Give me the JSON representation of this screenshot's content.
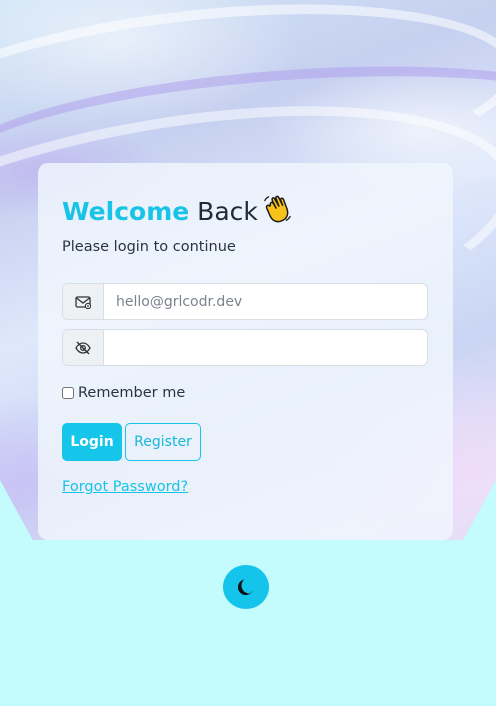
{
  "colors": {
    "accent": "#17c3e6",
    "text": "#222a35",
    "page_background": "#c4fbfd"
  },
  "login_card": {
    "title_accent": "Welcome",
    "title_rest": "Back",
    "title_icon": "waving-hand-icon",
    "subtitle": "Please login to continue",
    "email_field": {
      "icon": "envelope-icon",
      "value": "",
      "placeholder": "hello@grlcodr.dev"
    },
    "password_field": {
      "icon": "eye-slash-icon",
      "value": "",
      "placeholder": ""
    },
    "remember_me": {
      "label": "Remember me",
      "checked": false
    },
    "login_button": "Login",
    "register_button": "Register",
    "forgot_password_link": "Forgot Password?"
  },
  "theme_toggle": {
    "icon": "moon-icon"
  }
}
